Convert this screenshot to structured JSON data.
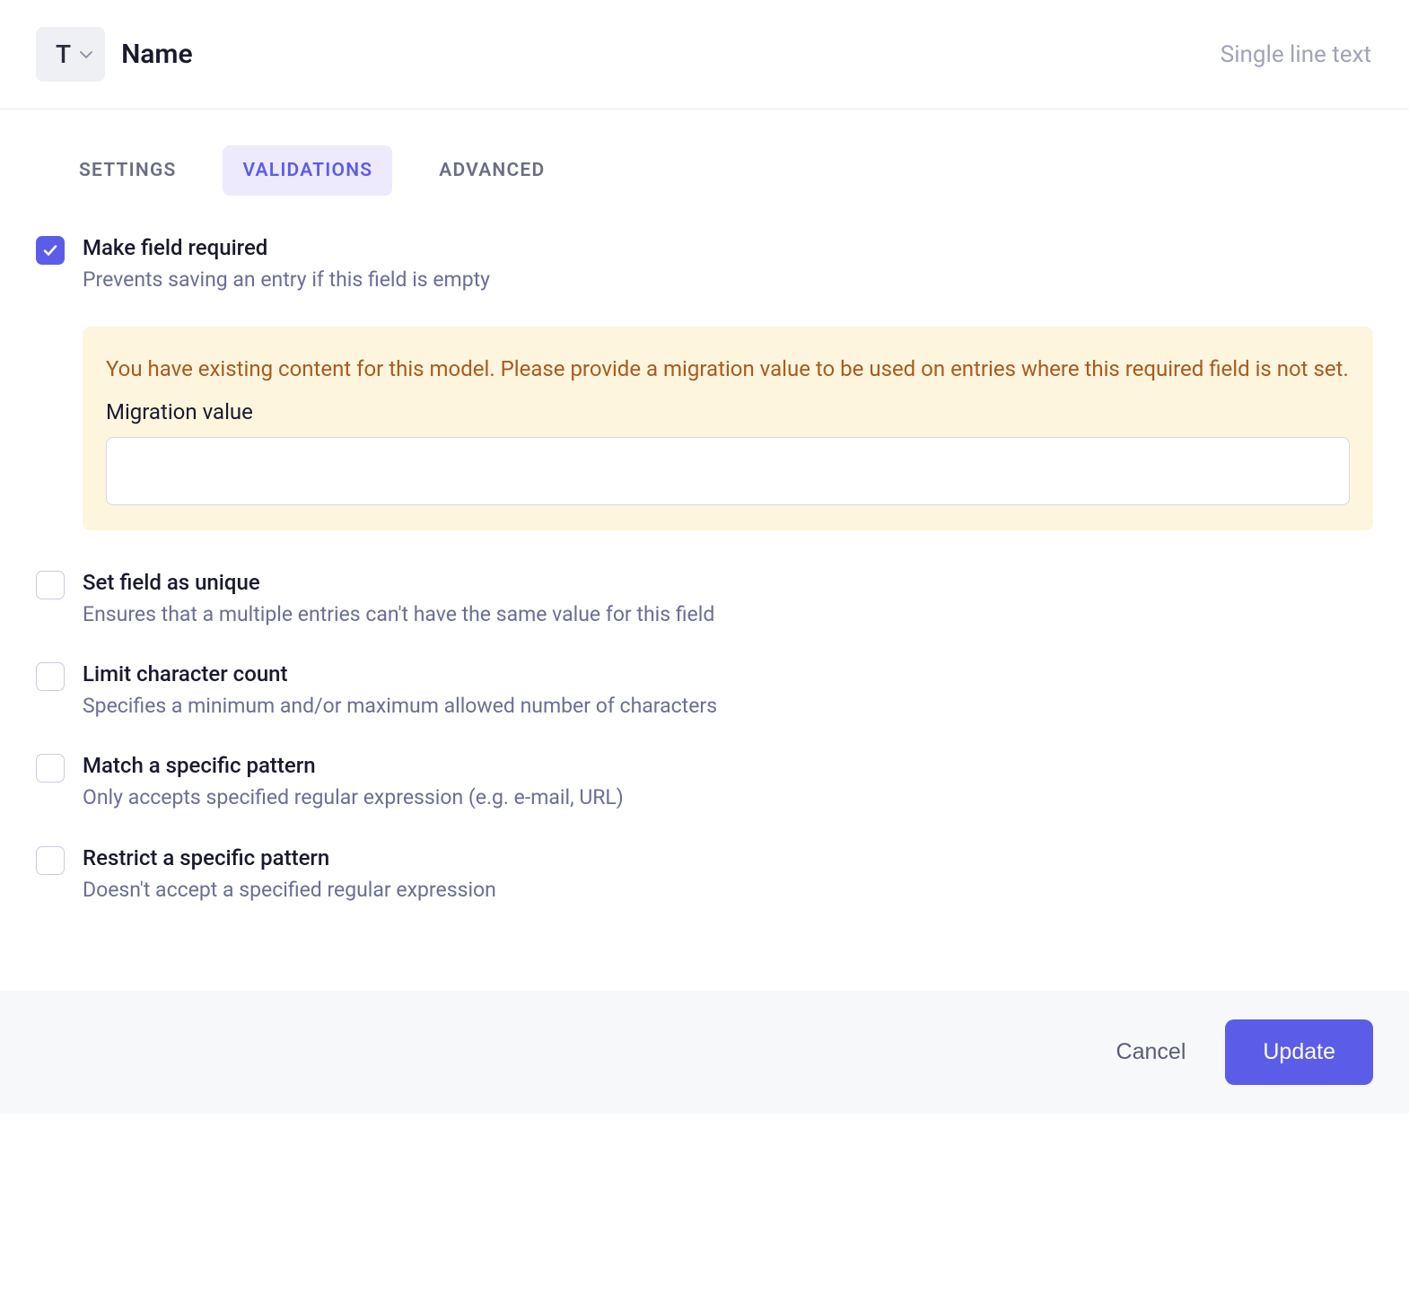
{
  "header": {
    "type_indicator": "T",
    "field_name": "Name",
    "field_type": "Single line text"
  },
  "tabs": {
    "settings": "SETTINGS",
    "validations": "VALIDATIONS",
    "advanced": "ADVANCED"
  },
  "options": {
    "required": {
      "title": "Make field required",
      "desc": "Prevents saving an entry if this field is empty"
    },
    "unique": {
      "title": "Set field as unique",
      "desc": "Ensures that a multiple entries can't have the same value for this field"
    },
    "limit": {
      "title": "Limit character count",
      "desc": "Specifies a minimum and/or maximum allowed number of characters"
    },
    "match": {
      "title": "Match a specific pattern",
      "desc": "Only accepts specified regular expression (e.g. e-mail, URL)"
    },
    "restrict": {
      "title": "Restrict a specific pattern",
      "desc": "Doesn't accept a specified regular expression"
    }
  },
  "warning": {
    "message": "You have existing content for this model. Please provide a migration value to be used on entries where this required field is not set.",
    "input_label": "Migration value",
    "input_value": ""
  },
  "footer": {
    "cancel": "Cancel",
    "update": "Update"
  }
}
